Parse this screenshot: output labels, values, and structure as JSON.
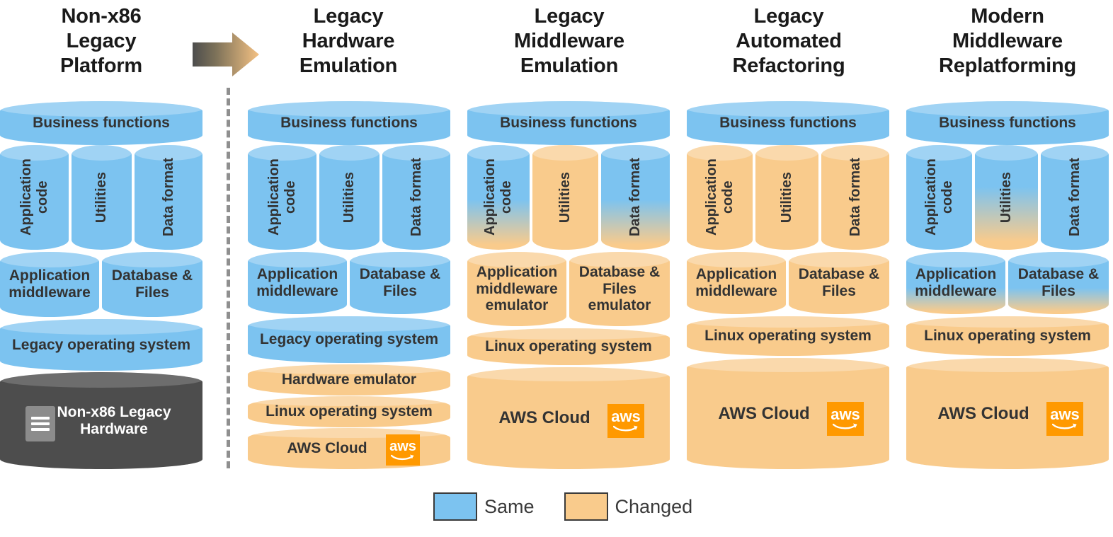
{
  "diagram": {
    "title_row": [
      {
        "id": "col1",
        "lines": [
          "Non-x86",
          "Legacy",
          "Platform"
        ]
      },
      {
        "id": "col2",
        "lines": [
          "Legacy",
          "Hardware",
          "Emulation"
        ]
      },
      {
        "id": "col3",
        "lines": [
          "Legacy",
          "Middleware",
          "Emulation"
        ]
      },
      {
        "id": "col4",
        "lines": [
          "Legacy",
          "Automated",
          "Refactoring"
        ]
      },
      {
        "id": "col5",
        "lines": [
          "Modern",
          "Middleware",
          "Replatforming"
        ]
      }
    ],
    "arrow": {
      "name": "migration-arrow",
      "from_color": "#4D4D4D",
      "to_color": "#F9CB8C"
    },
    "divider": {
      "name": "dashed-separator",
      "color": "#8F8F8F",
      "style": "dashed"
    },
    "legend": {
      "items": [
        {
          "label": "Same",
          "color": "#7CC3F0"
        },
        {
          "label": "Changed",
          "color": "#F9CB8C"
        }
      ]
    },
    "colors": {
      "same_blue": "#7CC3F0",
      "changed_orange": "#F9CB8C",
      "hardware_dark": "#4D4D4D",
      "aws_orange": "#FF9900",
      "text_dark": "#333333"
    },
    "columns": [
      {
        "id": "col1",
        "layers": {
          "business_functions": "Business functions",
          "application_code": "Application code",
          "utilities": "Utilities",
          "data_format": "Data format",
          "application_middleware": "Application middleware",
          "database_files": "Database & Files",
          "operating_system": "Legacy operating system",
          "hardware": "Non-x86 Legacy Hardware"
        }
      },
      {
        "id": "col2",
        "layers": {
          "business_functions": "Business functions",
          "application_code": "Application code",
          "utilities": "Utilities",
          "data_format": "Data format",
          "application_middleware": "Application middleware",
          "database_files": "Database & Files",
          "operating_system": "Legacy operating system",
          "hardware_emulator": "Hardware emulator",
          "linux_os": "Linux operating system",
          "cloud": "AWS Cloud"
        }
      },
      {
        "id": "col3",
        "layers": {
          "business_functions": "Business functions",
          "application_code": "Application code",
          "utilities": "Utilities",
          "data_format": "Data format",
          "application_middleware": "Application middleware emulator",
          "database_files": "Database & Files emulator",
          "linux_os": "Linux operating system",
          "cloud": "AWS Cloud"
        }
      },
      {
        "id": "col4",
        "layers": {
          "business_functions": "Business functions",
          "application_code": "Application code",
          "utilities": "Utilities",
          "data_format": "Data format",
          "application_middleware": "Application middleware",
          "database_files": "Database & Files",
          "linux_os": "Linux operating system",
          "cloud": "AWS Cloud"
        }
      },
      {
        "id": "col5",
        "layers": {
          "business_functions": "Business functions",
          "application_code": "Application code",
          "utilities": "Utilities",
          "data_format": "Data format",
          "application_middleware": "Application middleware",
          "database_files": "Database & Files",
          "linux_os": "Linux operating system",
          "cloud": "AWS Cloud"
        }
      }
    ],
    "aws_logo_text": "aws"
  }
}
